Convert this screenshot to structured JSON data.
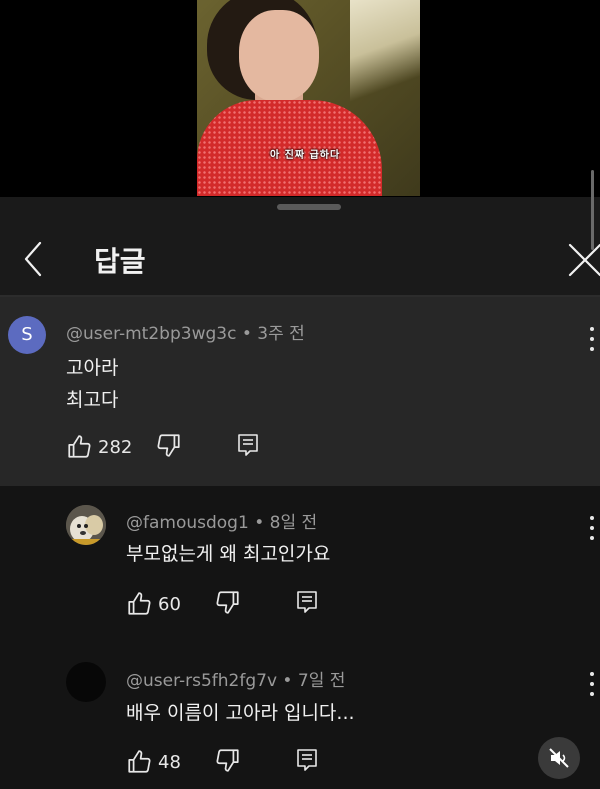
{
  "video": {
    "subtitle": "아 진짜 급하다"
  },
  "header": {
    "title": "답글"
  },
  "parent_comment": {
    "avatar_letter": "S",
    "author": "@user-mt2bp3wg3c",
    "time": "3주 전",
    "lines": [
      "고아라",
      "최고다"
    ],
    "likes": "282"
  },
  "replies": [
    {
      "author": "@famousdog1",
      "time": "8일 전",
      "text": "부모없는게 왜 최고인가요",
      "likes": "60"
    },
    {
      "author": "@user-rs5fh2fg7v",
      "time": "7일 전",
      "text": "배우 이름이 고아라 입니다...",
      "likes": "48"
    }
  ],
  "separator": " • ",
  "colors": {
    "sheet": "#1a1a1a",
    "highlight": "#272727",
    "avatar_s": "#5c6bc0"
  },
  "icons": [
    "chevron-left-icon",
    "close-icon",
    "thumbs-up-icon",
    "thumbs-down-icon",
    "reply-icon",
    "more-vertical-icon",
    "mute-icon"
  ]
}
